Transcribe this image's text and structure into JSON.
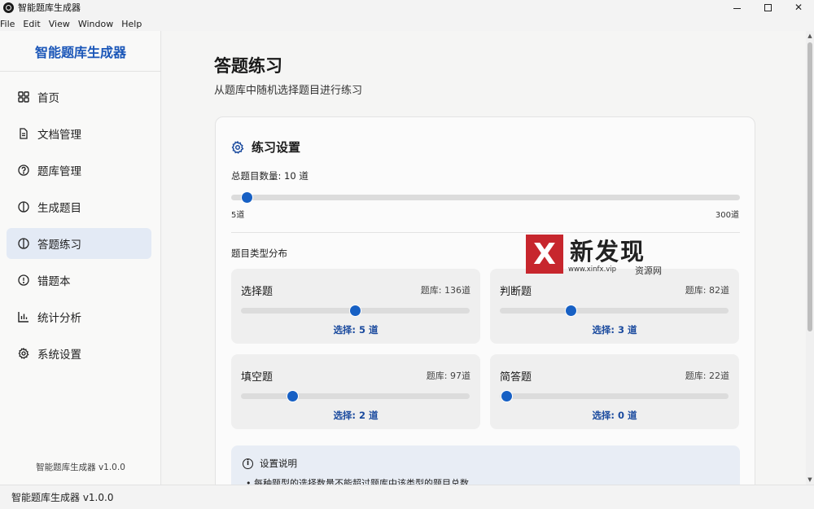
{
  "window": {
    "title": "智能题库生成器"
  },
  "menu": [
    "File",
    "Edit",
    "View",
    "Window",
    "Help"
  ],
  "sidebar": {
    "brand": "智能题库生成器",
    "items": [
      {
        "label": "首页",
        "icon": "grid-icon",
        "active": false
      },
      {
        "label": "文档管理",
        "icon": "document-icon",
        "active": false
      },
      {
        "label": "题库管理",
        "icon": "question-icon",
        "active": false
      },
      {
        "label": "生成题目",
        "icon": "generate-icon",
        "active": false
      },
      {
        "label": "答题练习",
        "icon": "practice-icon",
        "active": true
      },
      {
        "label": "错题本",
        "icon": "alert-icon",
        "active": false
      },
      {
        "label": "统计分析",
        "icon": "bar-chart-icon",
        "active": false
      },
      {
        "label": "系统设置",
        "icon": "gear-icon",
        "active": false
      }
    ],
    "footer": "智能题库生成器 v1.0.0"
  },
  "main": {
    "title": "答题练习",
    "subtitle": "从题库中随机选择题目进行练习",
    "settings": {
      "title": "练习设置",
      "total_label": "总题目数量: 10 道",
      "total_value": 10,
      "total_min": 5,
      "total_max": 300,
      "min_label": "5道",
      "max_label": "300道",
      "dist_label": "题目类型分布",
      "types": [
        {
          "name": "选择题",
          "bank": "题库: 136道",
          "selected": "选择: 5 道",
          "position": 0.5
        },
        {
          "name": "判断题",
          "bank": "题库: 82道",
          "selected": "选择: 3 道",
          "position": 0.3
        },
        {
          "name": "填空题",
          "bank": "题库: 97道",
          "selected": "选择: 2 道",
          "position": 0.21
        },
        {
          "name": "简答题",
          "bank": "题库: 22道",
          "selected": "选择: 0 道",
          "position": 0.0
        }
      ],
      "info": {
        "title": "设置说明",
        "line": "• 每种题型的选择数量不能超过题库中该类型的题目总数"
      }
    }
  },
  "statusbar": {
    "text": "智能题库生成器 v1.0.0"
  },
  "watermark": {
    "letter": "X",
    "big": "新发现",
    "url": "www.xinfx.vip",
    "small": "资源网"
  },
  "colors": {
    "accent": "#1760c4",
    "brand": "#1a56b8",
    "active_nav": "#e3eaf5",
    "watermark_red": "#c7262d"
  }
}
